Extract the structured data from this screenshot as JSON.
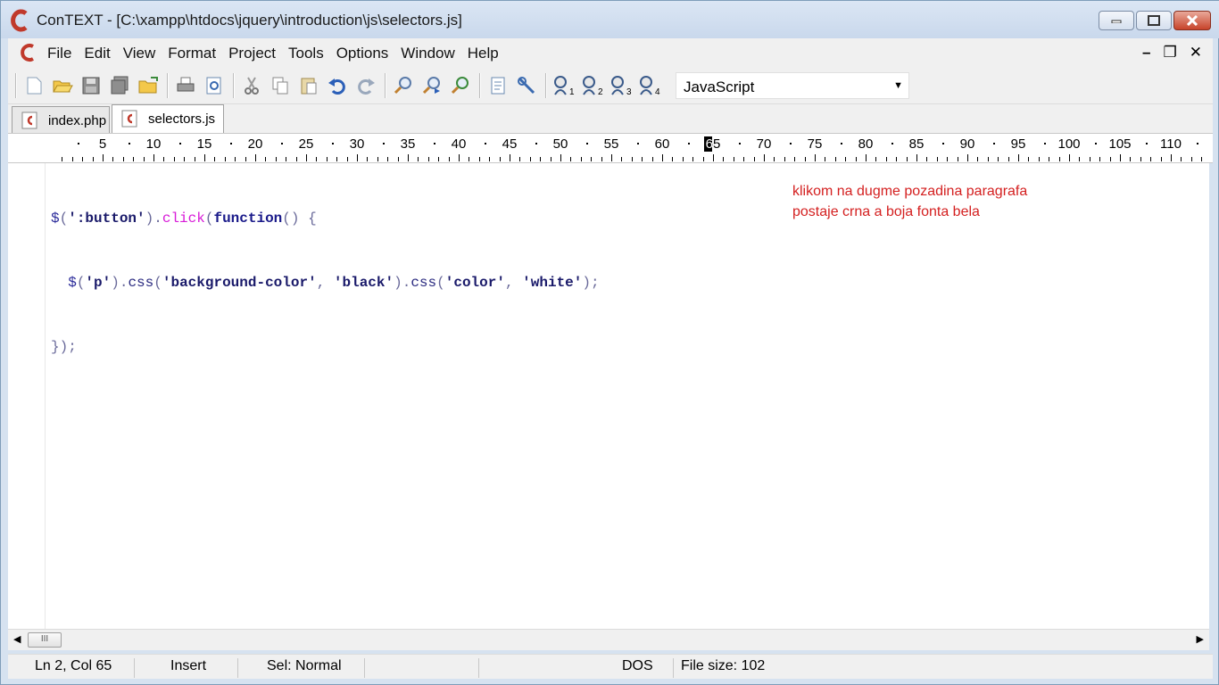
{
  "window": {
    "title": "ConTEXT - [C:\\xampp\\htdocs\\jquery\\introduction\\js\\selectors.js]",
    "logo_letter": "C",
    "brand_color": "#c0392b"
  },
  "menubar": {
    "items": [
      "File",
      "Edit",
      "View",
      "Format",
      "Project",
      "Tools",
      "Options",
      "Window",
      "Help"
    ],
    "mdi_minimize": "–",
    "mdi_restore": "❐",
    "mdi_close": "✕"
  },
  "toolbar": {
    "icons": [
      "new-file",
      "open-file",
      "save",
      "save-all",
      "open-folder",
      "print",
      "print-preview",
      "cut",
      "copy",
      "paste",
      "undo",
      "redo",
      "find",
      "find-next",
      "replace",
      "file-compare",
      "settings",
      "macro-1",
      "macro-2",
      "macro-3",
      "macro-4"
    ],
    "language": "JavaScript"
  },
  "tabs": [
    {
      "label": "index.php",
      "active": false
    },
    {
      "label": "selectors.js",
      "active": true
    }
  ],
  "ruler": {
    "labels": [
      "5",
      "10",
      "15",
      "20",
      "25",
      "30",
      "35",
      "40",
      "45",
      "50",
      "55",
      "60",
      "65",
      "70",
      "75",
      "80",
      "85",
      "90",
      "95",
      "100",
      "105",
      "110"
    ],
    "cursor_column": 65
  },
  "editor": {
    "lines": [
      "$(':button').click(function() {",
      "  $('p').css('background-color', 'black').css('color', 'white');",
      "});"
    ],
    "note_line1": "klikom na dugme pozadina paragrafa",
    "note_line2": "postaje crna a boja fonta bela",
    "note_color": "#d42020"
  },
  "scrollbar": {
    "thumb_grip": "III"
  },
  "statusbar": {
    "position": "Ln 2, Col 65",
    "mode": "Insert",
    "sel": "Sel: Normal",
    "line_ending": "DOS",
    "file_size": "File size: 102"
  }
}
